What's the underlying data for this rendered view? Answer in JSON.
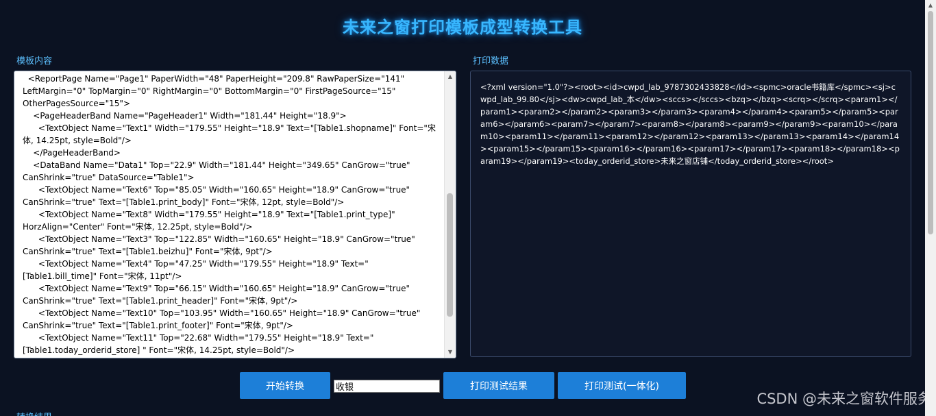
{
  "app": {
    "title": "未来之窗打印模板成型转换工具"
  },
  "labels": {
    "template": "模板内容",
    "print_data": "打印数据",
    "result": "转换结果"
  },
  "template_text": "  <ReportPage Name=\"Page1\" PaperWidth=\"48\" PaperHeight=\"209.8\" RawPaperSize=\"141\" LeftMargin=\"0\" TopMargin=\"0\" RightMargin=\"0\" BottomMargin=\"0\" FirstPageSource=\"15\" OtherPagesSource=\"15\">\n    <PageHeaderBand Name=\"PageHeader1\" Width=\"181.44\" Height=\"18.9\">\n      <TextObject Name=\"Text1\" Width=\"179.55\" Height=\"18.9\" Text=\"[Table1.shopname]\" Font=\"宋体, 14.25pt, style=Bold\"/>\n    </PageHeaderBand>\n    <DataBand Name=\"Data1\" Top=\"22.9\" Width=\"181.44\" Height=\"349.65\" CanGrow=\"true\" CanShrink=\"true\" DataSource=\"Table1\">\n      <TextObject Name=\"Text6\" Top=\"85.05\" Width=\"160.65\" Height=\"18.9\" CanGrow=\"true\" CanShrink=\"true\" Text=\"[Table1.print_body]\" Font=\"宋体, 12pt, style=Bold\"/>\n      <TextObject Name=\"Text8\" Width=\"179.55\" Height=\"18.9\" Text=\"[Table1.print_type]\" HorzAlign=\"Center\" Font=\"宋体, 12.25pt, style=Bold\"/>\n      <TextObject Name=\"Text3\" Top=\"122.85\" Width=\"160.65\" Height=\"18.9\" CanGrow=\"true\" CanShrink=\"true\" Text=\"[Table1.beizhu]\" Font=\"宋体, 9pt\"/>\n      <TextObject Name=\"Text4\" Top=\"47.25\" Width=\"179.55\" Height=\"18.9\" Text=\"[Table1.bill_time]\" Font=\"宋体, 11pt\"/>\n      <TextObject Name=\"Text9\" Top=\"66.15\" Width=\"160.65\" Height=\"18.9\" CanGrow=\"true\" CanShrink=\"true\" Text=\"[Table1.print_header]\" Font=\"宋体, 9pt\"/>\n      <TextObject Name=\"Text10\" Top=\"103.95\" Width=\"160.65\" Height=\"18.9\" CanGrow=\"true\" CanShrink=\"true\" Text=\"[Table1.print_footer]\" Font=\"宋体, 9pt\"/>\n      <TextObject Name=\"Text11\" Top=\"22.68\" Width=\"179.55\" Height=\"18.9\" Text=\"[Table1.today_orderid_store] \" Font=\"宋体, 14.25pt, style=Bold\"/>",
  "print_data_text": "<?xml version=\"1.0\"?><root><id>cwpd_lab_9787302433828</id><spmc>oracle书籍库</spmc><sj>cwpd_lab_99.80</sj><dw>cwpd_lab_本</dw><sccs></sccs><bzq></bzq><scrq></scrq><param1></param1><param2></param2><param3></param3><param4></param4><param5></param5><param6></param6><param7></param7><param8></param8><param9></param9><param10></param10><param11></param11><param12></param12><param13></param13><param14></param14><param15></param15><param16></param16><param17></param17><param18></param18><param19></param19><today_orderid_store>未来之窗店铺</today_orderid_store></root>",
  "controls": {
    "convert_label": "开始转换",
    "printer_value": "收银",
    "test_result_label": "打印测试结果",
    "test_unified_label": "打印测试(一体化)"
  },
  "watermark": "CSDN @未来之窗软件服务",
  "icons": {
    "scroll_up": "triangle-up-icon",
    "scroll_down": "triangle-down-icon"
  },
  "colors": {
    "background": "#0b1222",
    "title": "#38b7ff",
    "label": "#5cc0ff",
    "button": "#1d7fd8"
  }
}
